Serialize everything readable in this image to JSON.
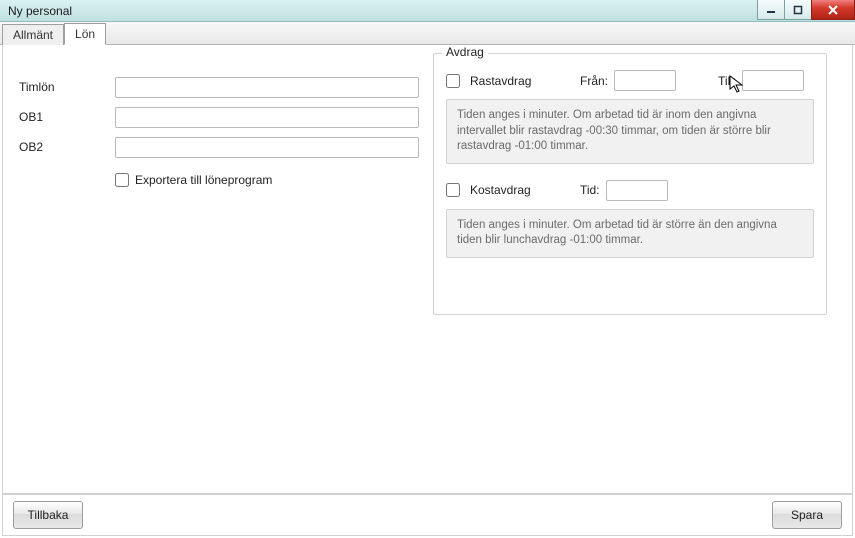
{
  "window": {
    "title": "Ny personal"
  },
  "tabs": {
    "allmant": "Allmänt",
    "lon": "Lön"
  },
  "left": {
    "timlon_label": "Timlön",
    "timlon_value": "",
    "ob1_label": "OB1",
    "ob1_value": "",
    "ob2_label": "OB2",
    "ob2_value": "",
    "export_label": "Exportera till löneprogram"
  },
  "avdrag": {
    "title": "Avdrag",
    "rastavdrag_label": "Rastavdrag",
    "fran_label": "Från:",
    "fran_value": "",
    "till_label": "Till:",
    "till_value": "",
    "rast_help": "Tiden anges i minuter. Om arbetad tid är inom den angivna intervallet blir rastavdrag -00:30 timmar, om tiden är större blir rastavdrag -01:00 timmar.",
    "kostavdrag_label": "Kostavdrag",
    "tid_label": "Tid:",
    "tid_value": "",
    "kost_help": "Tiden anges i minuter.  Om arbetad tid är större än den angivna tiden blir lunchavdrag  -01:00 timmar."
  },
  "footer": {
    "back": "Tillbaka",
    "save": "Spara"
  }
}
